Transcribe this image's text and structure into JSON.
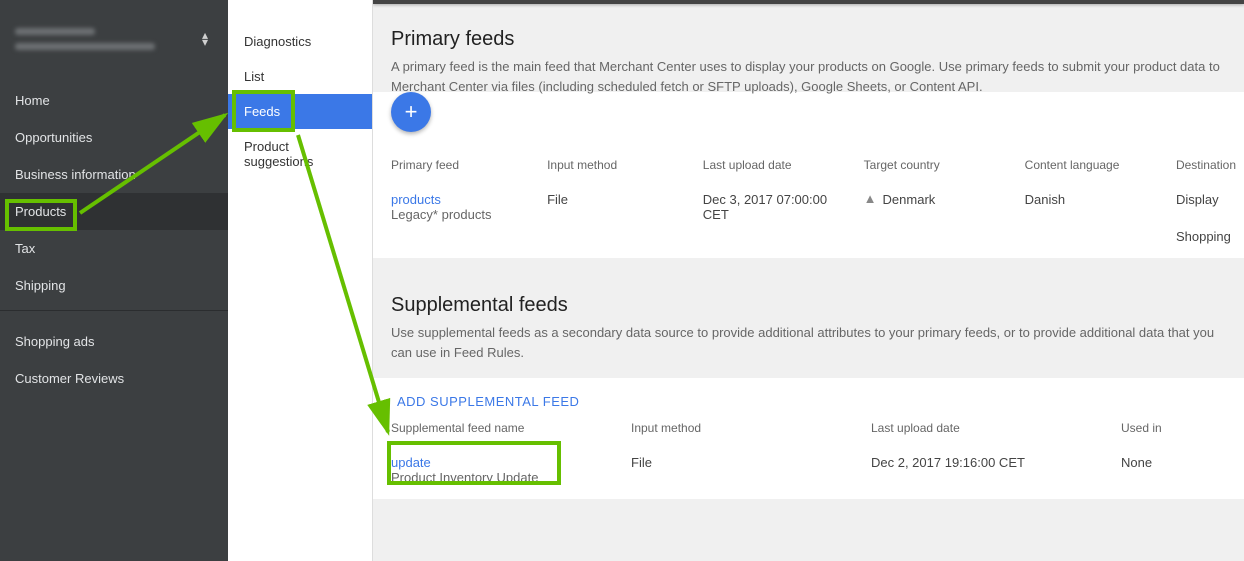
{
  "sidebar": {
    "items": [
      {
        "label": "Home"
      },
      {
        "label": "Opportunities"
      },
      {
        "label": "Business information"
      },
      {
        "label": "Products",
        "active": true
      },
      {
        "label": "Tax"
      },
      {
        "label": "Shipping"
      },
      {
        "label": "Shopping ads"
      },
      {
        "label": "Customer Reviews"
      }
    ]
  },
  "subnav": {
    "items": [
      {
        "label": "Diagnostics"
      },
      {
        "label": "List"
      },
      {
        "label": "Feeds",
        "active": true
      },
      {
        "label": "Product suggestions"
      }
    ]
  },
  "primary": {
    "title": "Primary feeds",
    "desc": "A primary feed is the main feed that Merchant Center uses to display your products on Google. Use primary feeds to submit your product data to Merchant Center via files (including scheduled fetch or SFTP uploads), Google Sheets, or Content API.",
    "fab": "+",
    "columns": [
      "Primary feed",
      "Input method",
      "Last upload date",
      "Target country",
      "Content language",
      "Destination"
    ],
    "rows": [
      {
        "name": "products",
        "note": "Legacy* products",
        "method": "File",
        "date": "Dec 3, 2017 07:00:00 CET",
        "country": "Denmark",
        "lang": "Danish",
        "dest": [
          "Display",
          "Shopping"
        ]
      }
    ]
  },
  "supplemental": {
    "title": "Supplemental feeds",
    "desc": "Use supplemental feeds as a secondary data source to provide additional attributes to your primary feeds, or to provide additional data that you can use in Feed Rules.",
    "add_label": "ADD SUPPLEMENTAL FEED",
    "columns": [
      "Supplemental feed name",
      "Input method",
      "Last upload date",
      "Used in"
    ],
    "rows": [
      {
        "name": "update",
        "note": "Product Inventory Update",
        "method": "File",
        "date": "Dec 2, 2017 19:16:00 CET",
        "used": "None"
      }
    ]
  }
}
